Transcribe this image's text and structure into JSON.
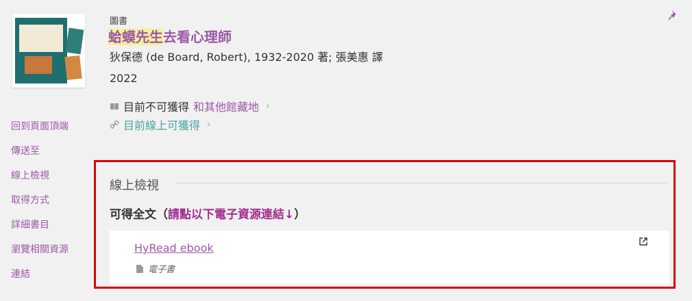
{
  "record": {
    "type_label": "圖書",
    "title_highlight": "蛤蟆先生",
    "title_rest": "去看心理師",
    "authors": "狄保德 (de Board, Robert), 1932-2020 著; 張美惠 譯",
    "year": "2022",
    "availability_status": "目前不可獲得",
    "availability_link": "和其他館藏地",
    "online_status": "目前線上可獲得"
  },
  "icons": {
    "pin": "pin-icon",
    "book": "book-icon",
    "link": "link-icon",
    "document": "document-icon",
    "external": "external-link-icon",
    "chevron": "chevron-right-icon"
  },
  "glyphs": {
    "chevron": "›"
  },
  "sidenav": {
    "items": [
      "回到頁面頂端",
      "傳送至",
      "線上檢視",
      "取得方式",
      "詳細書目",
      "瀏覽相關資源",
      "連結"
    ]
  },
  "panel": {
    "title": "線上檢視",
    "fulltext_label": "可得全文（",
    "fulltext_note": "請點以下電子資源連結↓",
    "fulltext_close": "）",
    "resource": {
      "link_text": "HyRead ebook",
      "type_text": "電子書"
    }
  },
  "colors": {
    "accent": "#9b59a7",
    "teal": "#4aa3a3",
    "highlight": "#f7ef9a",
    "frame": "#d60000"
  }
}
